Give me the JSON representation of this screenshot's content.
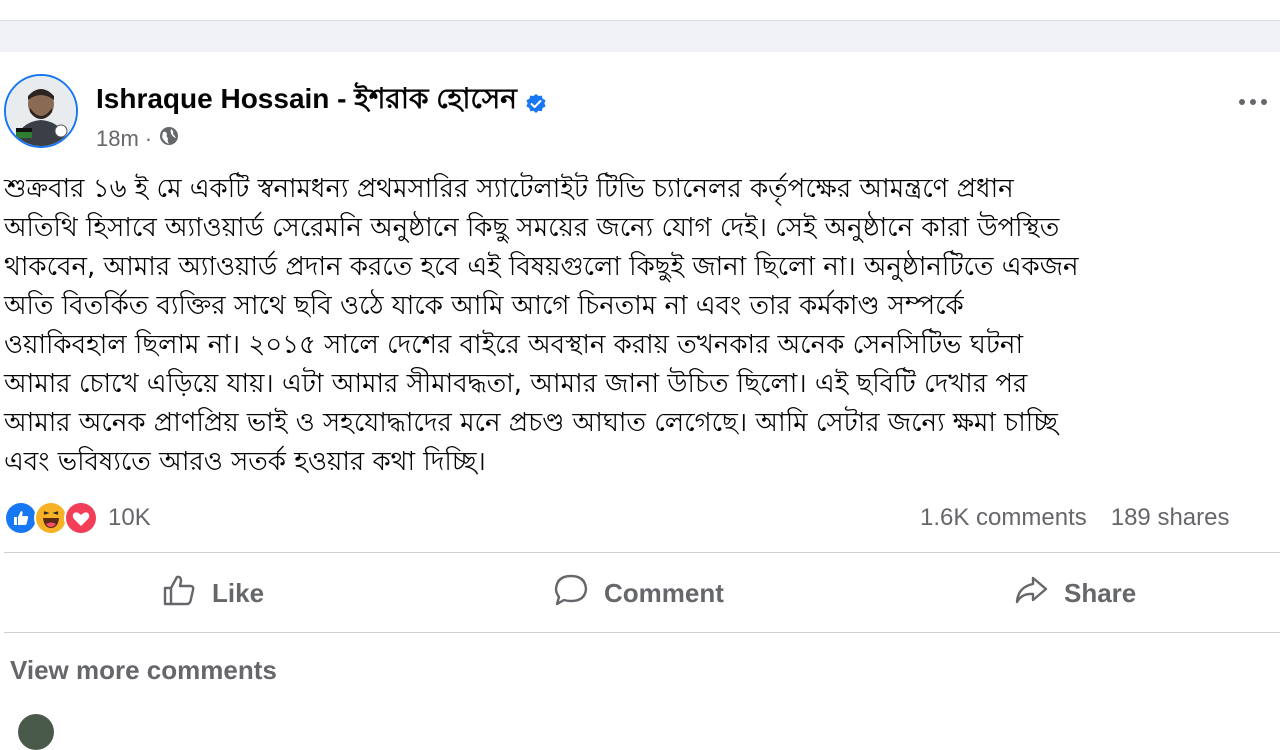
{
  "post": {
    "author": "Ishraque Hossain - ইশরাক হোসেন",
    "time": "18m",
    "separator": "·",
    "text_lines": [
      "শুক্রবার ১৬ ই মে একটি স্বনামধন্য প্রথমসারির স্যাটেলাইট টিভি চ্যানেলর কর্তৃপক্ষের আমন্ত্রণে প্রধান",
      "অতিথি হিসাবে অ্যাওয়ার্ড সেরেমনি অনুষ্ঠানে কিছু সময়ের জন্যে যোগ দেই। সেই অনুষ্ঠানে কারা উপস্থিত",
      "থাকবেন, আমার অ্যাওয়ার্ড প্রদান করতে হবে এই বিষয়গুলো কিছুই জানা ছিলো না। অনুষ্ঠানটিতে একজন",
      "অতি বিতর্কিত ব্যক্তির সাথে ছবি ওঠে যাকে আমি আগে চিনতাম না এবং তার কর্মকাণ্ড সম্পর্কে",
      "ওয়াকিবহাল ছিলাম না। ২০১৫ সালে দেশের বাইরে অবস্থান করায় তখনকার অনেক সেনসিটিভ ঘটনা",
      "আমার চোখে এড়িয়ে যায়। এটা আমার সীমাবদ্ধতা, আমার জানা উচিত ছিলো। এই ছবিটি দেখার পর",
      "আমার অনেক প্রাণপ্রিয় ভাই ও সহযোদ্ধাদের মনে প্রচণ্ড আঘাত লেগেছে। আমি সেটার জন্যে ক্ষমা চাচ্ছি",
      "এবং ভবিষ্যতে আরও সতর্ক হওয়ার কথা দিচ্ছি।"
    ]
  },
  "stats": {
    "reactions_count": "10K",
    "comments": "1.6K comments",
    "shares": "189 shares"
  },
  "actions": {
    "like": "Like",
    "comment": "Comment",
    "share": "Share"
  },
  "comments": {
    "view_more": "View more comments"
  },
  "colors": {
    "brand_blue": "#1877f2",
    "muted_text": "#65676b",
    "love_red": "#f33e58",
    "haha_yellow": "#f7b125"
  },
  "icons": {
    "verified": "verified-badge-icon",
    "globe": "globe-icon",
    "more": "more-options-icon",
    "like": "thumbs-up-icon",
    "comment": "speech-bubble-icon",
    "share": "share-arrow-icon"
  }
}
